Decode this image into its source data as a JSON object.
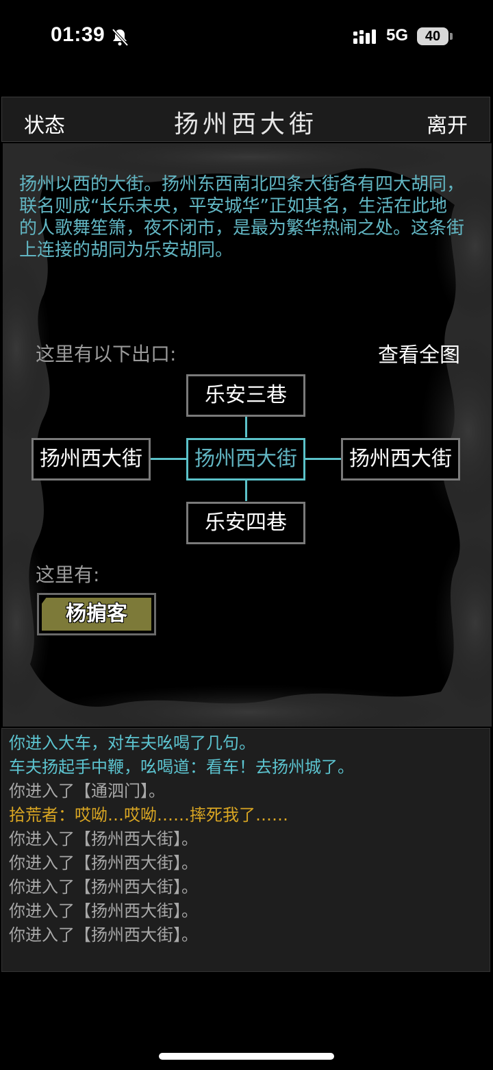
{
  "status_bar": {
    "time": "01:39",
    "network": "5G",
    "battery": "40"
  },
  "header": {
    "status_button": "状态",
    "title": "扬州西大街",
    "leave_button": "离开"
  },
  "room": {
    "description": "扬州以西的大街。扬州东西南北四条大街各有四大胡同，联名则成“长乐未央，平安城华”正如其名，生活在此地的人歌舞笙箫，夜不闭市，是最为繁华热闹之处。这条街上连接的胡同为乐安胡同。",
    "exits_label": "这里有以下出口:",
    "view_map_link": "查看全图",
    "exits": {
      "north": "乐安三巷",
      "west": "扬州西大街",
      "center": "扬州西大街",
      "east": "扬州西大街",
      "south": "乐安四巷"
    },
    "npcs_label": "这里有:",
    "npcs": [
      "杨掮客"
    ]
  },
  "log": [
    {
      "text": "你进入大车，对车夫吆喝了几句。",
      "color": "#5cc4d0"
    },
    {
      "text": "车夫扬起手中鞭，吆喝道：看车！去扬州城了。",
      "color": "#5cc4d0"
    },
    {
      "text": "你进入了【通泗门】。",
      "color": "#a8a8a8"
    },
    {
      "text": "拾荒者：哎呦…哎呦……摔死我了……",
      "color": "#d9a623"
    },
    {
      "text": "你进入了【扬州西大街】。",
      "color": "#a8a8a8"
    },
    {
      "text": "你进入了【扬州西大街】。",
      "color": "#a8a8a8"
    },
    {
      "text": "你进入了【扬州西大街】。",
      "color": "#a8a8a8"
    },
    {
      "text": "你进入了【扬州西大街】。",
      "color": "#a8a8a8"
    },
    {
      "text": "你进入了【扬州西大街】。",
      "color": "#a8a8a8"
    }
  ]
}
